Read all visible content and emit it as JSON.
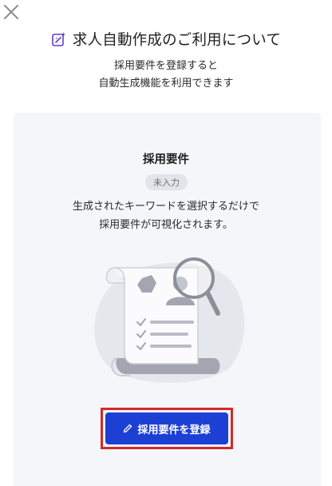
{
  "header": {
    "title": "求人自動作成のご利用について",
    "icon": "magic-edit-icon",
    "accent_color": "#5b3fd1"
  },
  "subtitle": {
    "line1": "採用要件を登録すると",
    "line2": "自動生成機能を利用できます"
  },
  "card": {
    "title": "採用要件",
    "badge": "未入力",
    "desc_line1": "生成されたキーワードを選択するだけで",
    "desc_line2": "採用要件が可視化されます。",
    "illustration": "resume-search-illustration"
  },
  "cta": {
    "label": "採用要件を登録",
    "icon": "pencil-icon",
    "color": "#1d40d4"
  },
  "close": {
    "icon": "close-icon"
  }
}
